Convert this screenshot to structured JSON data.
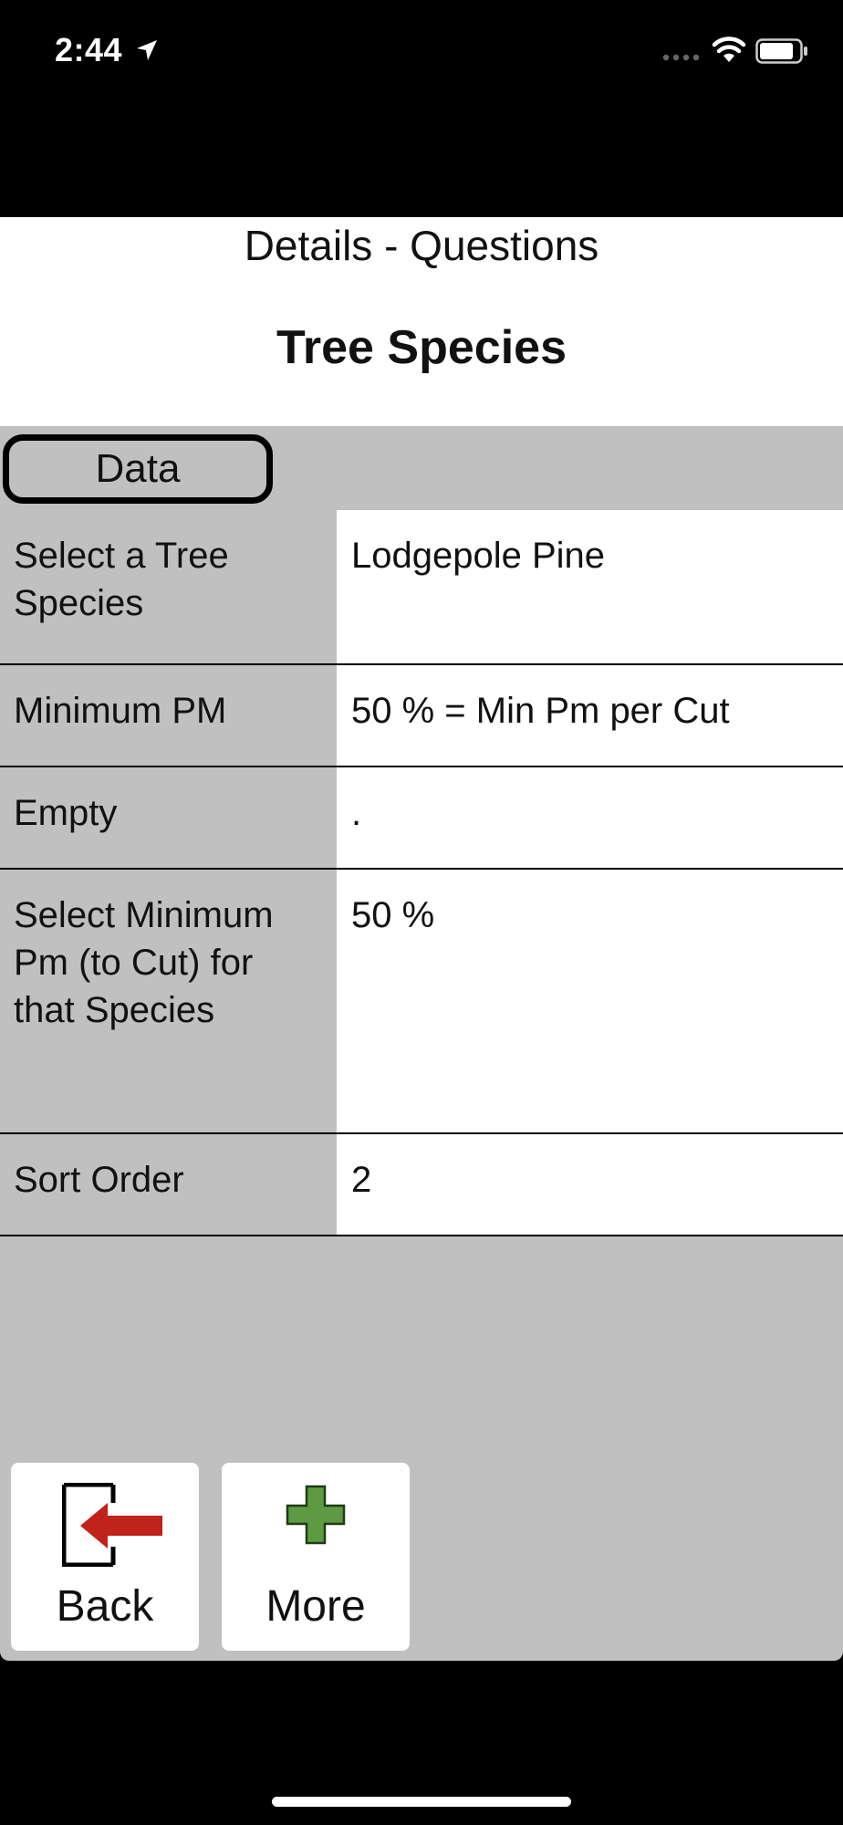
{
  "status_bar": {
    "time": "2:44"
  },
  "header": {
    "subtitle": "Details - Questions",
    "title": "Tree Species"
  },
  "section_tab": {
    "label": "Data"
  },
  "rows": [
    {
      "label": "Select a Tree Species",
      "value": "Lodgepole Pine"
    },
    {
      "label": "Minimum PM",
      "value": "50 % = Min Pm per Cut"
    },
    {
      "label": "Empty",
      "value": "."
    },
    {
      "label": "Select Minimum Pm (to Cut) for that Species",
      "value": "50 %"
    },
    {
      "label": "Sort Order",
      "value": "2"
    }
  ],
  "toolbar": {
    "back_label": "Back",
    "more_label": "More"
  },
  "colors": {
    "back_arrow": "#c0221c",
    "more_plus": "#5e9a42",
    "panel_bg": "#c0c0c0"
  }
}
